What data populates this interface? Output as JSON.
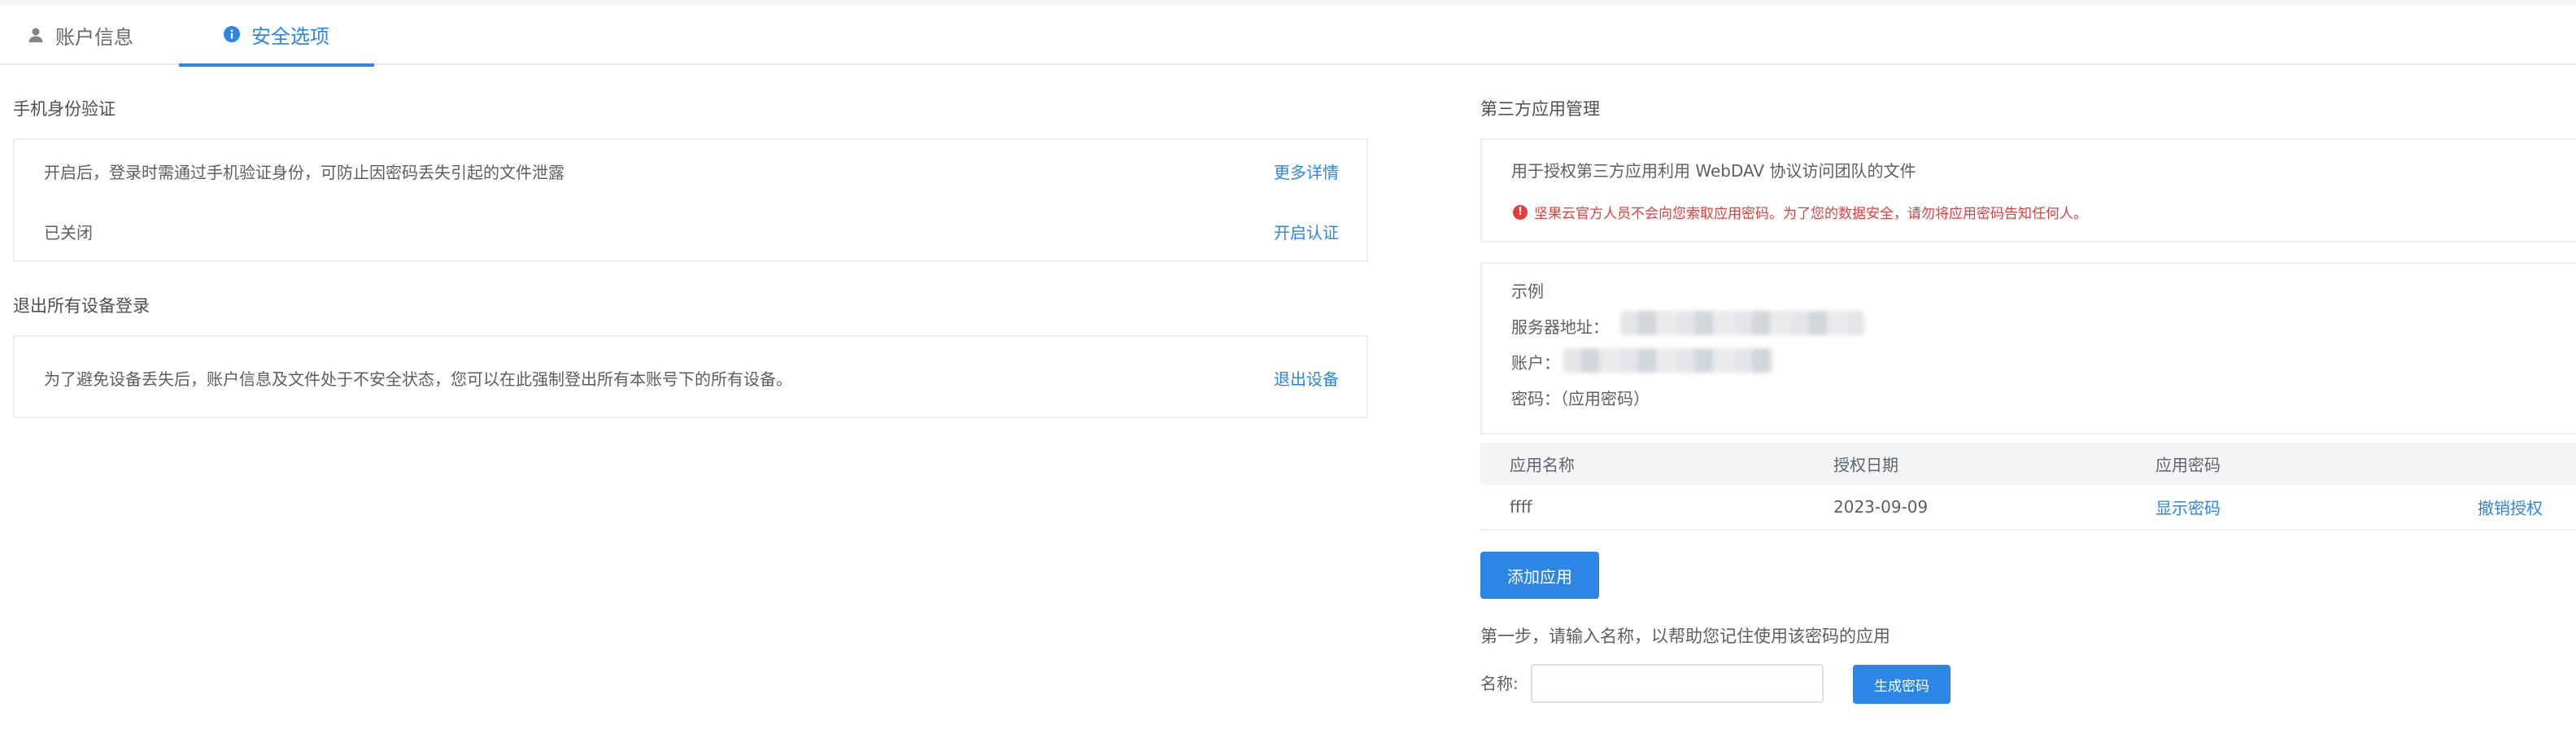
{
  "tabs": {
    "account": "账户信息",
    "security": "安全选项"
  },
  "phone_auth": {
    "title": "手机身份验证",
    "description": "开启后，登录时需通过手机验证身份，可防止因密码丢失引起的文件泄露",
    "more_link": "更多详情",
    "status": "已关闭",
    "enable_link": "开启认证"
  },
  "logout_all": {
    "title": "退出所有设备登录",
    "description": "为了避免设备丢失后，账户信息及文件处于不安全状态，您可以在此强制登出所有本账号下的所有设备。",
    "logout_link": "退出设备"
  },
  "third_party": {
    "title": "第三方应用管理",
    "description": "用于授权第三方应用利用 WebDAV 协议访问团队的文件",
    "warning": "坚果云官方人员不会向您索取应用密码。为了您的数据安全，请勿将应用密码告知任何人。",
    "example_title": "示例",
    "server_label": "服务器地址：",
    "account_label": "账户：",
    "password_label": "密码：（应用密码）",
    "table": {
      "headers": [
        "应用名称",
        "授权日期",
        "应用密码"
      ],
      "rows": [
        {
          "name": "ffff",
          "date": "2023-09-09",
          "show_password": "显示密码",
          "revoke": "撤销授权"
        }
      ]
    },
    "add_button": "添加应用",
    "step_text": "第一步，请输入名称，以帮助您记住使用该密码的应用",
    "name_label": "名称:",
    "name_value": "",
    "generate_button": "生成密码"
  },
  "colors": {
    "accent": "#2b86e6",
    "warning": "#e53c3c"
  },
  "icons": {
    "account_tab": "user-icon",
    "security_tab": "info-icon",
    "warning": "alert-circle-icon"
  }
}
